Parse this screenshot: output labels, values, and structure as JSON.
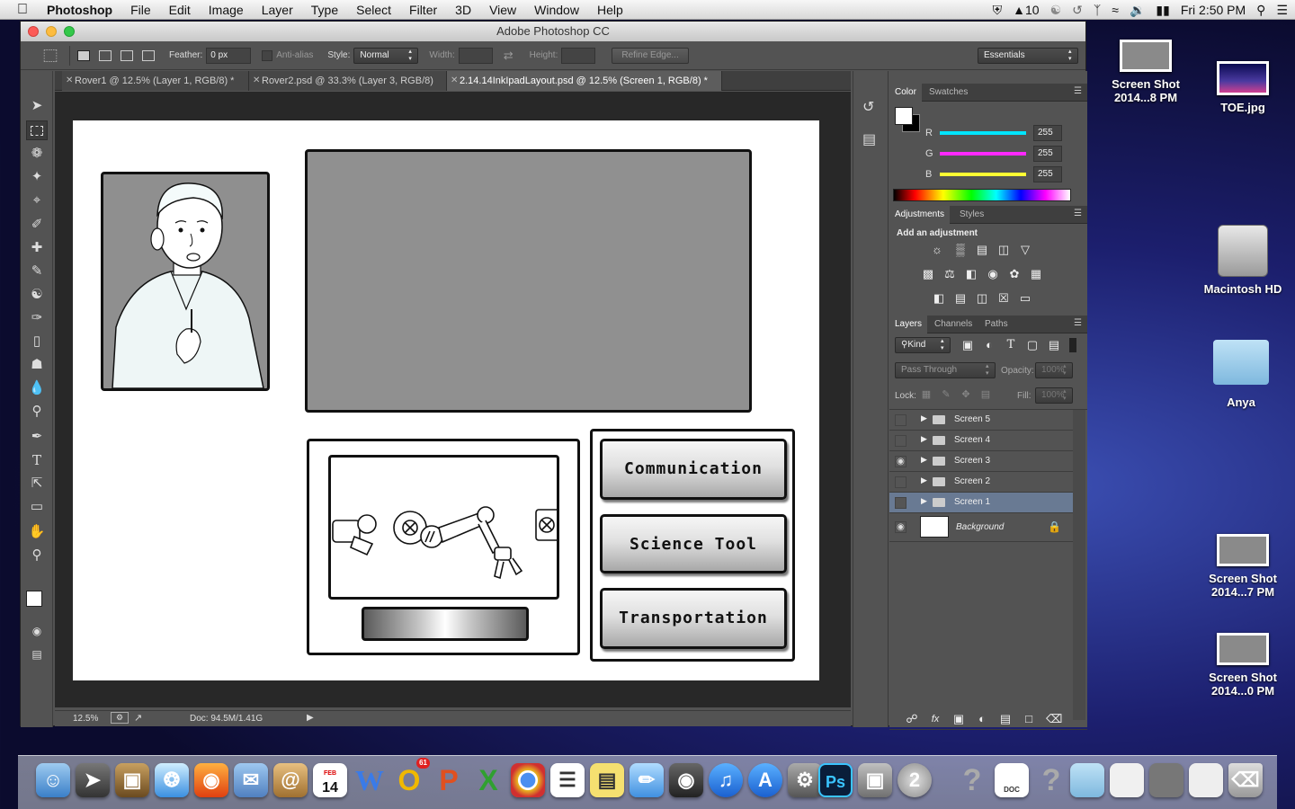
{
  "menubar": {
    "app": "Photoshop",
    "items": [
      "File",
      "Edit",
      "Image",
      "Layer",
      "Type",
      "Select",
      "Filter",
      "3D",
      "View",
      "Window",
      "Help"
    ],
    "status_battery_num": "10",
    "clock": "Fri 2:50 PM"
  },
  "window": {
    "title": "Adobe Photoshop CC"
  },
  "options": {
    "feather_label": "Feather:",
    "feather_value": "0 px",
    "antialias_label": "Anti-alias",
    "style_label": "Style:",
    "style_value": "Normal",
    "width_label": "Width:",
    "height_label": "Height:",
    "refine_edge": "Refine Edge...",
    "workspace": "Essentials"
  },
  "tabs": [
    {
      "label": "Rover1 @ 12.5% (Layer 1, RGB/8) *"
    },
    {
      "label": "Rover2.psd @ 33.3% (Layer 3, RGB/8)"
    },
    {
      "label": "2.14.14InkIpadLayout.psd @ 12.5% (Screen 1, RGB/8) *"
    }
  ],
  "document": {
    "buttons": [
      "Communication",
      "Science Tool",
      "Transportation"
    ]
  },
  "statusbar": {
    "zoom": "12.5%",
    "doc": "Doc: 94.5M/1.41G"
  },
  "color_panel": {
    "tabs": [
      "Color",
      "Swatches"
    ],
    "channels": [
      {
        "label": "R",
        "value": "255",
        "color": "#00e5ff"
      },
      {
        "label": "G",
        "value": "255",
        "color": "#ff29ff"
      },
      {
        "label": "B",
        "value": "255",
        "color": "#ffff33"
      }
    ]
  },
  "adjustments_panel": {
    "tabs": [
      "Adjustments",
      "Styles"
    ],
    "heading": "Add an adjustment"
  },
  "layers_panel": {
    "tabs": [
      "Layers",
      "Channels",
      "Paths"
    ],
    "kind": "Kind",
    "blend": "Pass Through",
    "opacity_label": "Opacity:",
    "opacity_value": "100%",
    "lock_label": "Lock:",
    "fill_label": "Fill:",
    "fill_value": "100%",
    "layers": [
      {
        "name": "Screen 5",
        "visible": false
      },
      {
        "name": "Screen 4",
        "visible": false
      },
      {
        "name": "Screen 3",
        "visible": true
      },
      {
        "name": "Screen 2",
        "visible": false
      },
      {
        "name": "Screen 1",
        "visible": false,
        "selected": true
      }
    ],
    "background": "Background"
  },
  "desktop": {
    "icons": [
      {
        "label": "Screen Shot\n2014...8 PM"
      },
      {
        "label": "TOE.jpg"
      },
      {
        "label": "Macintosh HD"
      },
      {
        "label": "Anya"
      },
      {
        "label": "Screen Shot\n2014...7 PM"
      },
      {
        "label": "Screen Shot\n2014...0 PM"
      }
    ]
  },
  "dock": {
    "calendar_month": "FEB",
    "calendar_day": "14",
    "badge": "61",
    "doc_label": "DOC"
  }
}
